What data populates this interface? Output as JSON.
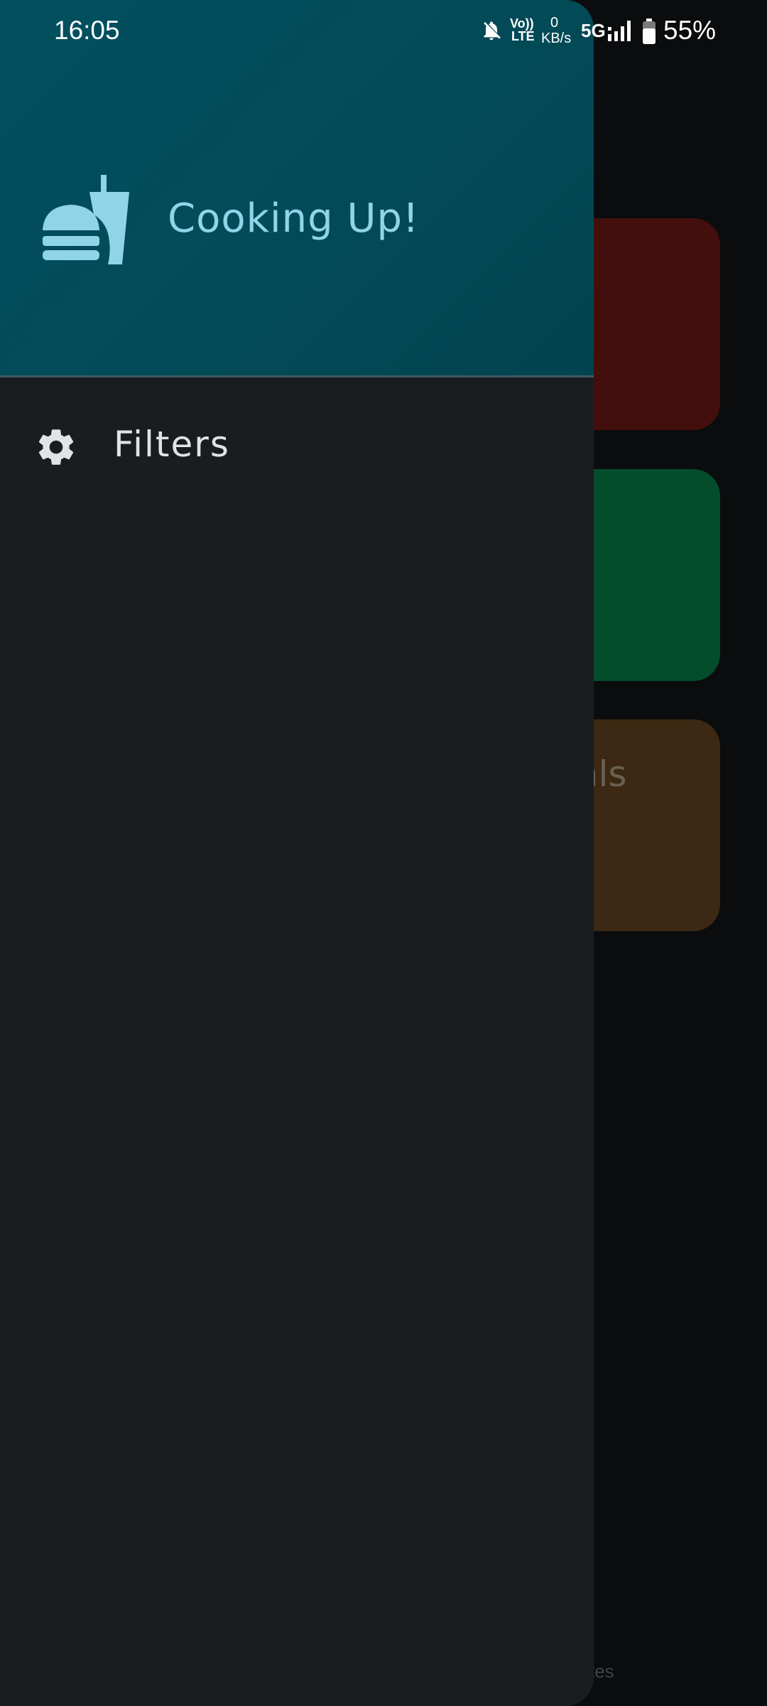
{
  "status_bar": {
    "time": "16:05",
    "volte_top": "Vo))",
    "volte_bottom": "LTE",
    "speed_value": "0",
    "speed_unit": "KB/s",
    "network": "5G",
    "battery_percent": "55%"
  },
  "background": {
    "card_3_label_fragment": "als",
    "nav_label_fragment": "tes",
    "card_colors": [
      "#430f0d",
      "#034d2c",
      "#3c2813"
    ]
  },
  "drawer": {
    "app_title": "Cooking Up!",
    "logo_icon": "fastfood-icon",
    "items": [
      {
        "label": "Filters",
        "icon": "gear-icon"
      }
    ],
    "accent_color": "#8fd4e7",
    "header_color": "#02505f"
  }
}
